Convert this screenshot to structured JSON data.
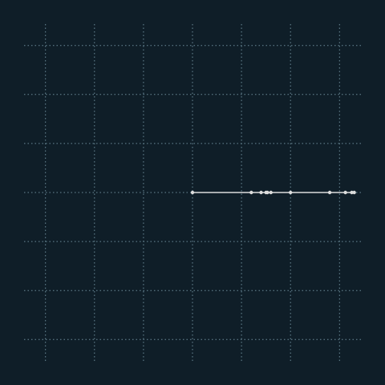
{
  "chart_data": {
    "type": "line",
    "title": "",
    "xlabel": "",
    "ylabel": "",
    "grid": true,
    "legend": "none",
    "xlim": [
      -3.0,
      3.3
    ],
    "ylim": [
      -3.3,
      3.3
    ],
    "xticks": [
      -3,
      -2,
      -1,
      0,
      1,
      2,
      3
    ],
    "yticks": [
      -3,
      -2,
      -1,
      0,
      1,
      2,
      3
    ],
    "series": [
      {
        "color": "#dcdcdc",
        "x": [
          0,
          1.2,
          1.4,
          1.5,
          1.53,
          1.6,
          2.0,
          2.8,
          3.12,
          3.25,
          3.3
        ],
        "y": [
          0,
          0,
          0,
          0,
          0,
          0,
          0,
          0,
          0,
          0,
          0
        ]
      }
    ],
    "colors": {
      "background": "#0f1e28",
      "grid": "#6b8a98",
      "line": "#dcdcdc"
    }
  }
}
